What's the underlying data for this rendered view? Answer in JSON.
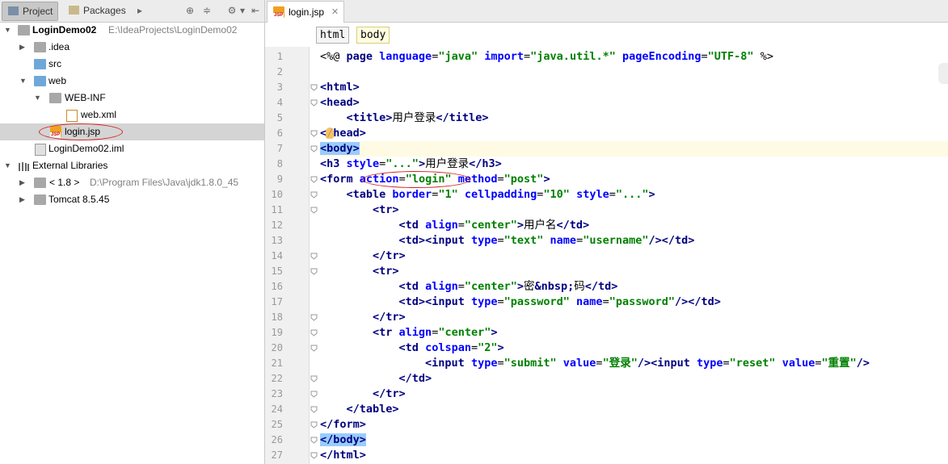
{
  "left_panel": {
    "tabs": [
      {
        "label": "Project"
      },
      {
        "label": "Packages"
      }
    ],
    "tree": [
      {
        "label": "LoginDemo02",
        "path": "E:\\IdeaProjects\\LoginDemo02"
      },
      {
        "label": ".idea"
      },
      {
        "label": "src"
      },
      {
        "label": "web"
      },
      {
        "label": "WEB-INF"
      },
      {
        "label": "web.xml"
      },
      {
        "label": "login.jsp"
      },
      {
        "label": "LoginDemo02.iml"
      },
      {
        "label": "External Libraries"
      },
      {
        "label": "< 1.8 >",
        "path": "D:\\Program Files\\Java\\jdk1.8.0_45"
      },
      {
        "label": "Tomcat 8.5.45"
      }
    ]
  },
  "editor": {
    "tab_label": "login.jsp",
    "breadcrumb": [
      "html",
      "body"
    ],
    "line_numbers": [
      "1",
      "2",
      "3",
      "4",
      "5",
      "6",
      "7",
      "8",
      "9",
      "10",
      "11",
      "12",
      "13",
      "14",
      "15",
      "16",
      "17",
      "18",
      "19",
      "20",
      "21",
      "22",
      "23",
      "24",
      "25",
      "26",
      "27"
    ],
    "code": {
      "l1_open": "<%@ ",
      "l1_page": "page ",
      "l1_attr1": "language",
      "l1_eq1": "=",
      "l1_val1": "\"java\"",
      "l1_sp1": " ",
      "l1_attr2": "import",
      "l1_eq2": "=",
      "l1_val2": "\"java.util.*\"",
      "l1_sp2": " ",
      "l1_attr3": "pageEncoding",
      "l1_eq3": "=",
      "l1_val3": "\"UTF-8\"",
      "l1_close": " %>",
      "l3": "<html>",
      "l4": "<head>",
      "l5_indent": "    ",
      "l5_open": "<title>",
      "l5_text": "用户登录",
      "l5_close": "</title>",
      "l6_a": "<",
      "l6_b": "/head>",
      "l7": "<body>",
      "l8_tag": "<h3 ",
      "l8_attr": "style",
      "l8_eq": "=",
      "l8_val": "\"...\"",
      "l8_gt": ">",
      "l8_text": "用户登录",
      "l8_close": "</h3>",
      "l9_tag": "<form ",
      "l9_attr1": "action",
      "l9_eq1": "=",
      "l9_val1": "\"login\"",
      "l9_sp": " ",
      "l9_attr2": "method",
      "l9_eq2": "=",
      "l9_val2": "\"post\"",
      "l9_gt": ">",
      "l10_indent": "    ",
      "l10_tag": "<table ",
      "l10_attr1": "border",
      "l10_eq1": "=",
      "l10_val1": "\"1\"",
      "l10_sp1": " ",
      "l10_attr2": "cellpadding",
      "l10_eq2": "=",
      "l10_val2": "\"10\"",
      "l10_sp2": " ",
      "l10_attr3": "style",
      "l10_eq3": "=",
      "l10_val3": "\"...\"",
      "l10_gt": ">",
      "l11_indent": "        ",
      "l11": "<tr>",
      "l12_indent": "            ",
      "l12_tag": "<td ",
      "l12_attr": "align",
      "l12_eq": "=",
      "l12_val": "\"center\"",
      "l12_gt": ">",
      "l12_text": "用户名",
      "l12_close": "</td>",
      "l13_indent": "            ",
      "l13_td": "<td>",
      "l13_tag": "<input ",
      "l13_attr1": "type",
      "l13_eq1": "=",
      "l13_val1": "\"text\"",
      "l13_sp": " ",
      "l13_attr2": "name",
      "l13_eq2": "=",
      "l13_val2": "\"username\"",
      "l13_end": "/>",
      "l13_close": "</td>",
      "l14_indent": "        ",
      "l14": "</tr>",
      "l15_indent": "        ",
      "l15": "<tr>",
      "l16_indent": "            ",
      "l16_tag": "<td ",
      "l16_attr": "align",
      "l16_eq": "=",
      "l16_val": "\"center\"",
      "l16_gt": ">",
      "l16_text1": "密",
      "l16_ent": "&nbsp;",
      "l16_text2": "码",
      "l16_close": "</td>",
      "l17_indent": "            ",
      "l17_td": "<td>",
      "l17_tag": "<input ",
      "l17_attr1": "type",
      "l17_eq1": "=",
      "l17_val1": "\"password\"",
      "l17_sp": " ",
      "l17_attr2": "name",
      "l17_eq2": "=",
      "l17_val2": "\"password\"",
      "l17_end": "/>",
      "l17_close": "</td>",
      "l18_indent": "        ",
      "l18": "</tr>",
      "l19_indent": "        ",
      "l19_tag": "<tr ",
      "l19_attr": "align",
      "l19_eq": "=",
      "l19_val": "\"center\"",
      "l19_gt": ">",
      "l20_indent": "            ",
      "l20_tag": "<td ",
      "l20_attr": "colspan",
      "l20_eq": "=",
      "l20_val": "\"2\"",
      "l20_gt": ">",
      "l21_indent": "                ",
      "l21_tag1": "<input ",
      "l21_attr1": "type",
      "l21_eq1": "=",
      "l21_val1": "\"submit\"",
      "l21_sp1": " ",
      "l21_attr2": "value",
      "l21_eq2": "=",
      "l21_val2": "\"登录\"",
      "l21_end1": "/>",
      "l21_tag2": "<input ",
      "l21_attr3": "type",
      "l21_eq3": "=",
      "l21_val3": "\"reset\"",
      "l21_sp2": " ",
      "l21_attr4": "value",
      "l21_eq4": "=",
      "l21_val4": "\"重置\"",
      "l21_end2": "/>",
      "l22_indent": "            ",
      "l22": "</td>",
      "l23_indent": "        ",
      "l23": "</tr>",
      "l24_indent": "    ",
      "l24": "</table>",
      "l25": "</form>",
      "l26": "</body>",
      "l27": "</html>"
    }
  }
}
